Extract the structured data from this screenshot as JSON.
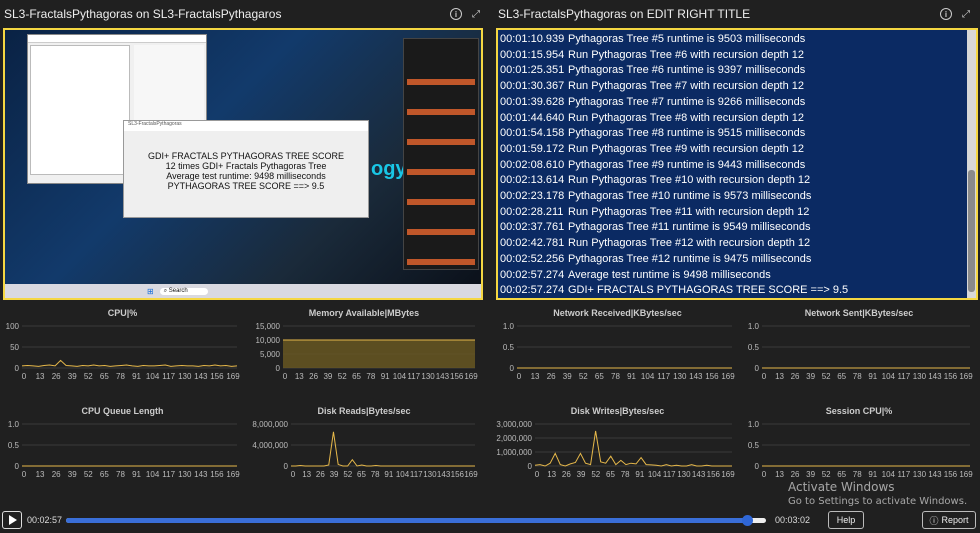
{
  "left_panel": {
    "title": "SL3-FractalsPythagoras on SL3-FractalsPythagaros"
  },
  "right_panel": {
    "title": "SL3-FractalsPythagoras on EDIT RIGHT TITLE"
  },
  "remote_desktop": {
    "dialog": {
      "title": "SL3-FractalsPythagoras",
      "lines": [
        "GDI+ FRACTALS PYTHAGORAS TREE SCORE",
        "12 times GDI+ Fractals Pythagoras Tree",
        "Average test runtime: 9498 milliseconds",
        "PYTHAGORAS TREE SCORE ==> 9.5"
      ]
    },
    "brand_text": "ogy.",
    "taskbar_search": "Search"
  },
  "log": [
    {
      "time": "00:01:10.939",
      "msg": "Pythagoras Tree #5 runtime is 9503 milliseconds"
    },
    {
      "time": "00:01:15.954",
      "msg": "Run Pythagoras Tree #6 with recursion depth 12"
    },
    {
      "time": "00:01:25.351",
      "msg": "Pythagoras Tree #6 runtime is 9397 milliseconds"
    },
    {
      "time": "00:01:30.367",
      "msg": "Run Pythagoras Tree #7 with recursion depth 12"
    },
    {
      "time": "00:01:39.628",
      "msg": "Pythagoras Tree #7 runtime is 9266 milliseconds"
    },
    {
      "time": "00:01:44.640",
      "msg": "Run Pythagoras Tree #8 with recursion depth 12"
    },
    {
      "time": "00:01:54.158",
      "msg": "Pythagoras Tree #8 runtime is 9515 milliseconds"
    },
    {
      "time": "00:01:59.172",
      "msg": "Run Pythagoras Tree #9 with recursion depth 12"
    },
    {
      "time": "00:02:08.610",
      "msg": "Pythagoras Tree #9 runtime is 9443 milliseconds"
    },
    {
      "time": "00:02:13.614",
      "msg": "Run Pythagoras Tree #10 with recursion depth 12"
    },
    {
      "time": "00:02:23.178",
      "msg": "Pythagoras Tree #10 runtime is 9573 milliseconds"
    },
    {
      "time": "00:02:28.211",
      "msg": "Run Pythagoras Tree #11 with recursion depth 12"
    },
    {
      "time": "00:02:37.761",
      "msg": "Pythagoras Tree #11 runtime is 9549 milliseconds"
    },
    {
      "time": "00:02:42.781",
      "msg": "Run Pythagoras Tree #12 with recursion depth 12"
    },
    {
      "time": "00:02:52.256",
      "msg": "Pythagoras Tree #12 runtime is 9475 milliseconds"
    },
    {
      "time": "00:02:57.274",
      "msg": "Average test runtime is 9498 milliseconds"
    },
    {
      "time": "00:02:57.274",
      "msg": "GDI+ FRACTALS PYTHAGORAS TREE SCORE ==> 9.5"
    }
  ],
  "x_ticks": [
    "0",
    "13",
    "26",
    "39",
    "52",
    "65",
    "78",
    "91",
    "104",
    "117",
    "130",
    "143",
    "156",
    "169"
  ],
  "charts": [
    {
      "id": "cpu",
      "title": "CPU|%",
      "y_ticks": [
        "100",
        "50",
        "0"
      ],
      "ylim": [
        0,
        100
      ],
      "values": [
        5,
        6,
        5,
        4,
        6,
        7,
        5,
        18,
        6,
        5,
        4,
        6,
        5,
        7,
        5,
        6,
        4,
        5,
        6,
        7,
        5,
        4,
        6,
        5,
        5,
        6,
        7,
        4,
        5,
        6,
        5,
        5,
        4,
        6,
        5,
        7,
        5,
        6,
        4,
        5
      ]
    },
    {
      "id": "memory",
      "title": "Memory Available|MBytes",
      "y_ticks": [
        "15,000",
        "10,000",
        "5,000",
        "0"
      ],
      "ylim": [
        0,
        15000
      ],
      "values": [
        10000,
        10000,
        10000,
        10000,
        10000,
        10000,
        10000,
        10000,
        10000,
        10000
      ],
      "filled": true
    },
    {
      "id": "net-received",
      "title": "Network Received|KBytes/sec",
      "y_ticks": [
        "1.0",
        "0.5",
        "0"
      ],
      "ylim": [
        0,
        1
      ],
      "values": [
        0,
        0,
        0,
        0,
        0,
        0,
        0,
        0,
        0,
        0
      ]
    },
    {
      "id": "net-sent",
      "title": "Network Sent|KBytes/sec",
      "y_ticks": [
        "1.0",
        "0.5",
        "0"
      ],
      "ylim": [
        0,
        1
      ],
      "values": [
        0,
        0,
        0,
        0,
        0,
        0,
        0,
        0,
        0,
        0
      ]
    },
    {
      "id": "cpu-queue",
      "title": "CPU Queue Length",
      "y_ticks": [
        "1.0",
        "0.5",
        "0"
      ],
      "ylim": [
        0,
        1
      ],
      "values": [
        0,
        0,
        0,
        0,
        0,
        0,
        0,
        0,
        0,
        0
      ]
    },
    {
      "id": "disk-reads",
      "title": "Disk Reads|Bytes/sec",
      "y_ticks": [
        "8,000,000",
        "4,000,000",
        "0"
      ],
      "ylim": [
        0,
        8000000
      ],
      "values": [
        0,
        0,
        100000,
        0,
        0,
        0,
        0,
        0,
        200000,
        6500000,
        300000,
        0,
        0,
        1200000,
        0,
        200000,
        0,
        0,
        100000,
        0,
        0,
        0,
        0,
        0,
        0,
        0,
        0,
        0,
        0,
        0,
        0,
        0,
        0,
        0,
        0,
        0,
        0,
        0,
        0,
        0
      ]
    },
    {
      "id": "disk-writes",
      "title": "Disk Writes|Bytes/sec",
      "y_ticks": [
        "3,000,000",
        "2,000,000",
        "1,000,000",
        "0"
      ],
      "ylim": [
        0,
        3000000
      ],
      "values": [
        50000,
        100000,
        0,
        200000,
        900000,
        100000,
        0,
        150000,
        250000,
        900000,
        200000,
        100000,
        2500000,
        300000,
        200000,
        700000,
        100000,
        400000,
        100000,
        200000,
        150000,
        600000,
        100000,
        80000,
        50000,
        0,
        100000,
        0,
        50000,
        0,
        0,
        100000,
        0,
        0,
        50000,
        0,
        0,
        0,
        0,
        0
      ]
    },
    {
      "id": "session-cpu",
      "title": "Session CPU|%",
      "y_ticks": [
        "1.0",
        "0.5",
        "0"
      ],
      "ylim": [
        0,
        1
      ],
      "values": [
        0,
        0,
        0,
        0,
        0,
        0,
        0,
        0,
        0,
        0
      ]
    }
  ],
  "player": {
    "elapsed": "00:02:57",
    "total": "00:03:02",
    "progress": 0.973,
    "help_label": "Help",
    "report_label": "Report"
  },
  "watermark": {
    "line1": "Activate Windows",
    "line2": "Go to Settings to activate Windows."
  },
  "colors": {
    "accent_border": "#f5d742",
    "series": "#e6b84a",
    "log_bg": "#0b2a63"
  }
}
